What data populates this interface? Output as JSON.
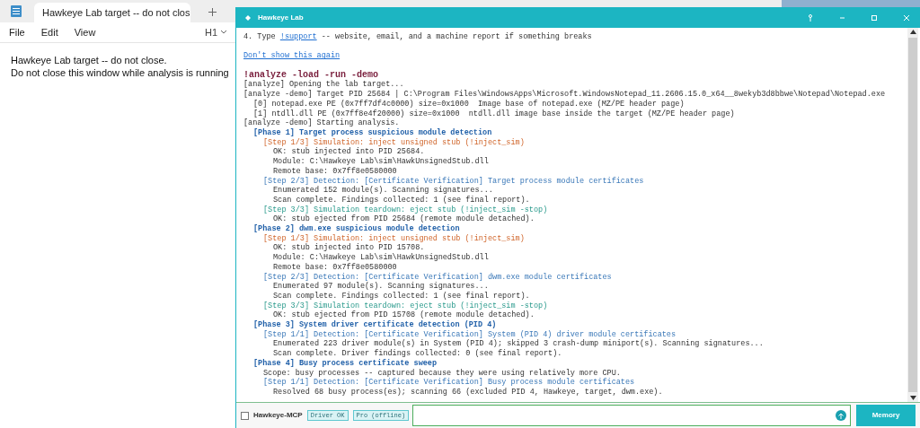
{
  "notepad": {
    "tab_title": "Hawkeye Lab target -- do not clos",
    "menu": [
      "File",
      "Edit",
      "View"
    ],
    "heading_level": "H1",
    "lines": [
      "Hawkeye Lab target -- do not close.",
      "Do not close this window while analysis is running"
    ]
  },
  "app": {
    "title": "Hawkeye Lab",
    "tip": {
      "prefix": "4. Type ",
      "link": "!support",
      "suffix": " -- website, email, and a machine report if something breaks"
    },
    "dismiss_link": "Don't show this again",
    "log": [
      {
        "kind": "command",
        "text": "!analyze -load -run -demo"
      },
      {
        "kind": "plain",
        "text": "[analyze] Opening the lab target..."
      },
      {
        "kind": "plain",
        "text": "[analyze -demo] Target PID 25684 | C:\\Program Files\\WindowsApps\\Microsoft.WindowsNotepad_11.2606.15.0_x64__8wekyb3d8bbwe\\Notepad\\Notepad.exe",
        "children": [
          {
            "kind": "plain",
            "text": "[0] notepad.exe PE (0x7ff7df4c0000) size=0x1000  Image base of notepad.exe (MZ/PE header page)"
          },
          {
            "kind": "plain",
            "text": "[1] ntdll.dll PE (0x7ff8e4f20000) size=0x1000  ntdll.dll image base inside the target (MZ/PE header page)"
          }
        ]
      },
      {
        "kind": "plain",
        "text": "[analyze -demo] Starting analysis.",
        "children": [
          {
            "kind": "phase",
            "text": "[Phase 1] Target process suspicious module detection",
            "children": [
              {
                "kind": "simulation",
                "text": "[Step 1/3] Simulation: inject unsigned stub (!inject_sim)",
                "children": [
                  {
                    "kind": "plain",
                    "text": "OK: stub injected into PID 25684."
                  },
                  {
                    "kind": "plain",
                    "text": "Module: C:\\Hawkeye Lab\\sim\\HawkUnsignedStub.dll"
                  },
                  {
                    "kind": "plain",
                    "text": "Remote base: 0x7ff8e0580000"
                  }
                ]
              },
              {
                "kind": "detection",
                "text": "[Step 2/3] Detection: [Certificate Verification] Target process module certificates",
                "children": [
                  {
                    "kind": "plain",
                    "text": "Enumerated 152 module(s). Scanning signatures..."
                  },
                  {
                    "kind": "plain",
                    "text": "Scan complete. Findings collected: 1 (see final report)."
                  }
                ]
              },
              {
                "kind": "teardown",
                "text": "[Step 3/3] Simulation teardown: eject stub (!inject_sim -stop)",
                "children": [
                  {
                    "kind": "plain",
                    "text": "OK: stub ejected from PID 25684 (remote module detached)."
                  }
                ]
              }
            ]
          },
          {
            "kind": "phase",
            "text": "[Phase 2] dwm.exe suspicious module detection",
            "children": [
              {
                "kind": "simulation",
                "text": "[Step 1/3] Simulation: inject unsigned stub (!inject_sim)",
                "children": [
                  {
                    "kind": "plain",
                    "text": "OK: stub injected into PID 15708."
                  },
                  {
                    "kind": "plain",
                    "text": "Module: C:\\Hawkeye Lab\\sim\\HawkUnsignedStub.dll"
                  },
                  {
                    "kind": "plain",
                    "text": "Remote base: 0x7ff8e0580000"
                  }
                ]
              },
              {
                "kind": "detection",
                "text": "[Step 2/3] Detection: [Certificate Verification] dwm.exe module certificates",
                "children": [
                  {
                    "kind": "plain",
                    "text": "Enumerated 97 module(s). Scanning signatures..."
                  },
                  {
                    "kind": "plain",
                    "text": "Scan complete. Findings collected: 1 (see final report)."
                  }
                ]
              },
              {
                "kind": "teardown",
                "text": "[Step 3/3] Simulation teardown: eject stub (!inject_sim -stop)",
                "children": [
                  {
                    "kind": "plain",
                    "text": "OK: stub ejected from PID 15708 (remote module detached)."
                  }
                ]
              }
            ]
          },
          {
            "kind": "phase",
            "text": "[Phase 3] System driver certificate detection (PID 4)",
            "children": [
              {
                "kind": "detection",
                "text": "[Step 1/1] Detection: [Certificate Verification] System (PID 4) driver module certificates",
                "children": [
                  {
                    "kind": "plain",
                    "text": "Enumerated 223 driver module(s) in System (PID 4); skipped 3 crash-dump miniport(s). Scanning signatures..."
                  },
                  {
                    "kind": "plain",
                    "text": "Scan complete. Driver findings collected: 0 (see final report)."
                  }
                ]
              }
            ]
          },
          {
            "kind": "phase",
            "text": "[Phase 4] Busy process certificate sweep",
            "children": [
              {
                "kind": "plain",
                "text": "Scope: busy processes -- captured because they were using relatively more CPU."
              },
              {
                "kind": "detection",
                "text": "[Step 1/1] Detection: [Certificate Verification] Busy process module certificates",
                "children": [
                  {
                    "kind": "plain",
                    "text": "Resolved 68 busy process(es); scanning 66 (excluded PID 4, Hawkeye, target, dwm.exe)."
                  }
                ]
              }
            ]
          }
        ]
      }
    ],
    "mcp": {
      "label": "Hawkeye-MCP",
      "checked": false
    },
    "badges": [
      "Driver OK",
      "Pro (offline)"
    ],
    "memory_button": "Memory"
  }
}
